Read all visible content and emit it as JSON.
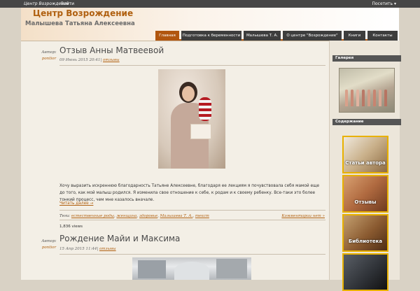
{
  "adminbar": {
    "site_name": "Центр Возрождение",
    "login": "Войти",
    "visit": "Посетить ▾"
  },
  "header": {
    "title": "Центр Возрождение",
    "description": "Малышева Татьяна Алексеевна"
  },
  "nav": {
    "tabs": [
      {
        "label": "Главная",
        "active": true
      },
      {
        "label": "Подготовка к беременности",
        "active": false
      },
      {
        "label": "Малышева Т. А.",
        "active": false
      },
      {
        "label": "О центре \"Возрождение\"",
        "active": false
      },
      {
        "label": "Книги",
        "active": false
      },
      {
        "label": "Контакты",
        "active": false
      }
    ]
  },
  "sidebar": {
    "gallery_title": "Галерея",
    "contents_title": "Содержание",
    "items": [
      "Статьи автора",
      "Отзывы",
      "Библиотека",
      ""
    ]
  },
  "posts": [
    {
      "author_label": "Автор:",
      "author_name": "pontior",
      "title": "Отзыв Анны Матвеевой",
      "date": "09 Июнь 2015 20:41",
      "category": "отзывы",
      "excerpt": "Хочу выразить искреннюю благодарность Татьяне Алексеевне, благодаря ее лекциям я почувствовала себя мамой еще до того, как мой малыш родился. Я изменила свое отношение к себе, к родам и к своему ребенку. Все-таки это более тонкий процесс, чем мне казалось вначале.",
      "more": "Читать далее →",
      "tags_label": "Теги:",
      "tags": [
        "естественные роды",
        "женщина",
        "здоровье",
        "Малышева Т. А.",
        "текст"
      ],
      "comments": "Комментарии нет »",
      "views": "1,836 views"
    },
    {
      "author_label": "Автор:",
      "author_name": "pontior",
      "title": "Рождение Майи и Максима",
      "date": "15 Апр 2015 11:44",
      "category": "отзывы"
    }
  ],
  "colors": {
    "accent": "#b1560f",
    "link": "#b06010",
    "thumb_border": "#e8b100"
  }
}
